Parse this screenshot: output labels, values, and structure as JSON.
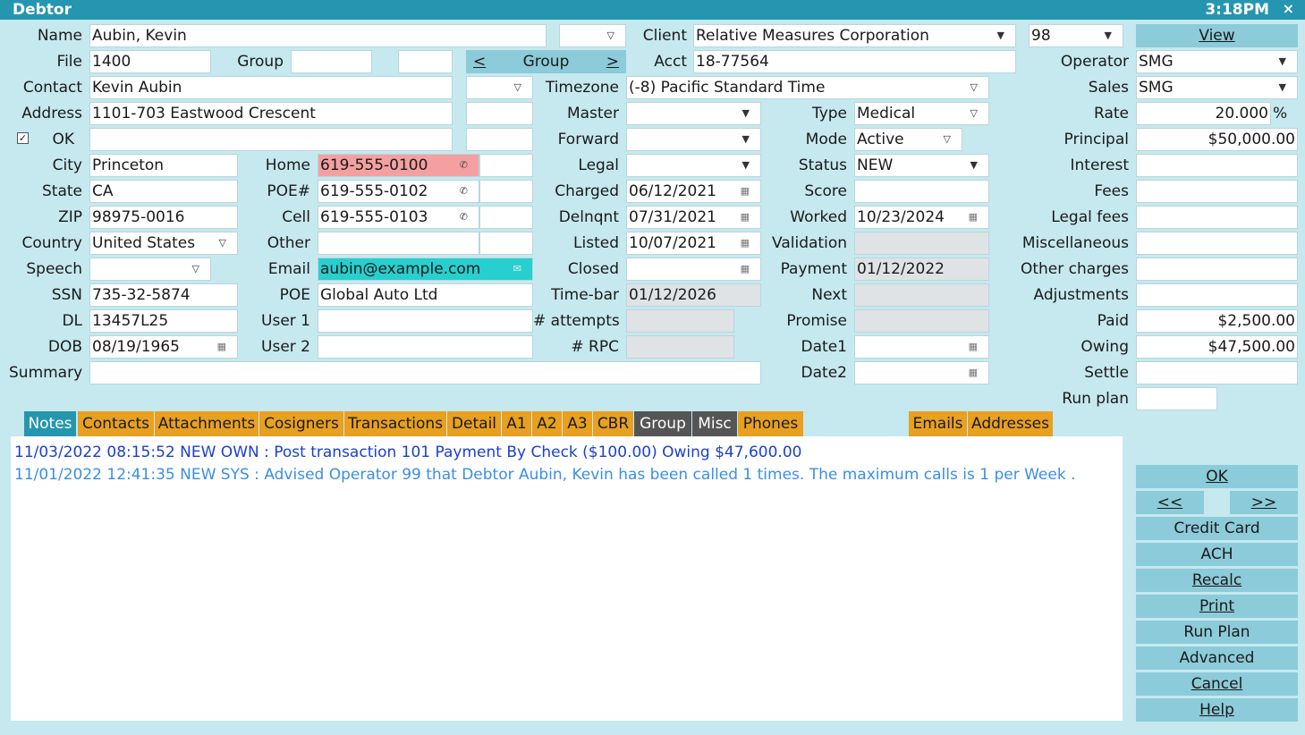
{
  "window": {
    "title": "Debtor",
    "time": "3:18PM",
    "close": "×"
  },
  "labels": {
    "name": "Name",
    "file": "File",
    "group": "Group",
    "contact": "Contact",
    "address": "Address",
    "ok": "OK",
    "city": "City",
    "state": "State",
    "zip": "ZIP",
    "country": "Country",
    "speech": "Speech",
    "ssn": "SSN",
    "dl": "DL",
    "dob": "DOB",
    "summary": "Summary",
    "home": "Home",
    "poe_num": "POE#",
    "cell": "Cell",
    "other": "Other",
    "email": "Email",
    "poe": "POE",
    "user1": "User 1",
    "user2": "User 2",
    "client": "Client",
    "acct": "Acct",
    "timezone": "Timezone",
    "master": "Master",
    "forward": "Forward",
    "legal": "Legal",
    "charged": "Charged",
    "delnqnt": "Delnqnt",
    "listed": "Listed",
    "closed": "Closed",
    "timebar": "Time-bar",
    "attempts": "# attempts",
    "rpc": "# RPC",
    "type": "Type",
    "mode": "Mode",
    "status": "Status",
    "score": "Score",
    "worked": "Worked",
    "validation": "Validation",
    "payment": "Payment",
    "next": "Next",
    "promise": "Promise",
    "date1": "Date1",
    "date2": "Date2",
    "operator": "Operator",
    "sales": "Sales",
    "rate": "Rate",
    "principal": "Principal",
    "interest": "Interest",
    "fees": "Fees",
    "legal_fees": "Legal fees",
    "misc": "Miscellaneous",
    "other_charges": "Other charges",
    "adjustments": "Adjustments",
    "paid": "Paid",
    "owing": "Owing",
    "settle": "Settle",
    "run_plan": "Run plan",
    "pct": "%"
  },
  "values": {
    "name": "Aubin, Kevin",
    "file": "1400",
    "group": "",
    "contact": "Kevin Aubin",
    "address": "1101-703 Eastwood Crescent",
    "address2": "",
    "city": "Princeton",
    "state": "CA",
    "zip": "98975-0016",
    "country": "United States",
    "speech": "",
    "ssn": "735-32-5874",
    "dl": "13457L25",
    "dob": "08/19/1965",
    "summary": "",
    "home": "619-555-0100",
    "poe_num": "619-555-0102",
    "cell": "619-555-0103",
    "other": "",
    "email": "aubin@example.com",
    "poe": "Global Auto Ltd",
    "user1": "",
    "user2": "",
    "client": "Relative Measures Corporation",
    "client_code": "98",
    "acct": "18-77564",
    "timezone": "(-8) Pacific Standard Time",
    "master": "",
    "forward": "",
    "legal": "",
    "charged": "06/12/2021",
    "delnqnt": "07/31/2021",
    "listed": "10/07/2021",
    "closed": "",
    "timebar": "01/12/2026",
    "attempts": "",
    "rpc": "",
    "type": "Medical",
    "mode": "Active",
    "status": "NEW",
    "score": "",
    "worked": "10/23/2024",
    "validation": "",
    "payment": "01/12/2022",
    "next": "",
    "promise": "",
    "date1": "",
    "date2": "",
    "operator": "SMG",
    "sales": "SMG",
    "rate": "20.000",
    "principal": "$50,000.00",
    "interest": "",
    "fees": "",
    "legal_fees": "",
    "misc": "",
    "other_charges": "",
    "adjustments": "",
    "paid": "$2,500.00",
    "owing": "$47,500.00",
    "settle": "",
    "run_plan": ""
  },
  "buttons": {
    "view": "View",
    "group_prev": "<",
    "group": "Group",
    "group_next": ">",
    "ok": "OK",
    "prev": "<<",
    "next": ">>",
    "credit_card": "Credit Card",
    "ach": "ACH",
    "recalc": "Recalc",
    "print": "Print",
    "run_plan": "Run Plan",
    "advanced": "Advanced",
    "cancel": "Cancel",
    "help": "Help"
  },
  "tabs": {
    "notes": "Notes",
    "contacts": "Contacts",
    "attachments": "Attachments",
    "cosigners": "Cosigners",
    "transactions": "Transactions",
    "detail": "Detail",
    "a1": "A1",
    "a2": "A2",
    "a3": "A3",
    "cbr": "CBR",
    "group": "Group",
    "misc": "Misc",
    "phones": "Phones",
    "emails": "Emails",
    "addresses": "Addresses"
  },
  "notes": [
    {
      "text": "11/03/2022 08:15:52 NEW OWN : Post transaction 101 Payment By Check ($100.00) Owing $47,600.00",
      "color": "#1a3fd1"
    },
    {
      "text": "11/01/2022 12:41:35 NEW SYS : Advised Operator 99 that Debtor Aubin, Kevin has been called 1 times. The maximum calls is 1 per Week .",
      "color": "#3a8ee6"
    }
  ],
  "icons": {
    "dropdown": "chevron-down-icon",
    "phone": "phone-icon",
    "calendar": "calendar-icon",
    "mail": "mail-icon"
  },
  "colors": {
    "background": "#c6e8ef",
    "titlebar": "#2596b0",
    "tab": "#e8a020",
    "tab_active": "#2596b0",
    "button": "#8ccbd9",
    "home_phone": "#f5a0a0",
    "email": "#28cfcf"
  }
}
